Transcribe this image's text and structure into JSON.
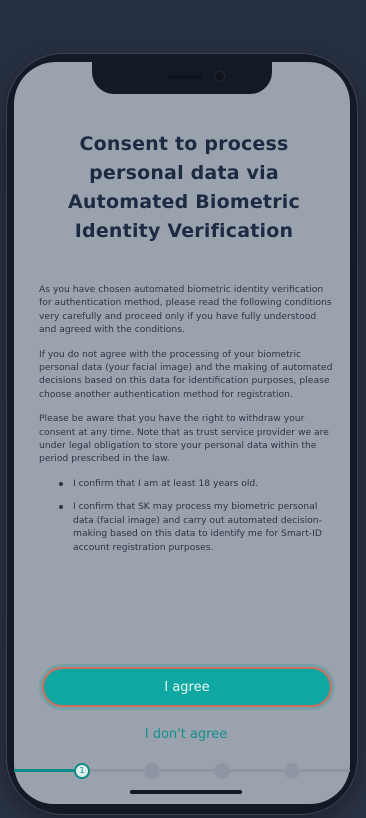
{
  "consent": {
    "title": "Consent to process personal data via Automated Biometric Identity Verification",
    "paragraphs": [
      "As you have chosen automated biometric identity verification for authentication method, please read the following conditions very carefully and proceed only if you have fully understood and agreed with the conditions.",
      "If you do not agree with the processing of your biometric personal data (your facial image) and the making of automated decisions based on this data for identification purposes, please choose another authentication method for registration.",
      "Please be aware that you have the right to withdraw your consent at any time. Note that as trust service provider we are under legal obligation to store your personal data within the period prescribed in the law."
    ],
    "bullets": [
      "I confirm that I am at least 18 years old.",
      "I confirm that SK may process my biometric personal data (facial image) and carry out automated decision-making based on this data to identify me for Smart-ID account registration purposes."
    ]
  },
  "actions": {
    "agree_label": "I agree",
    "disagree_label": "I don't agree"
  },
  "progress": {
    "current_step": "1"
  },
  "colors": {
    "accent": "#0fa7a1",
    "title": "#1c2a42",
    "screen_background": "#9aa2ae"
  },
  "icons": {
    "camera": "camera-icon",
    "speaker": "speaker-grille-icon"
  }
}
